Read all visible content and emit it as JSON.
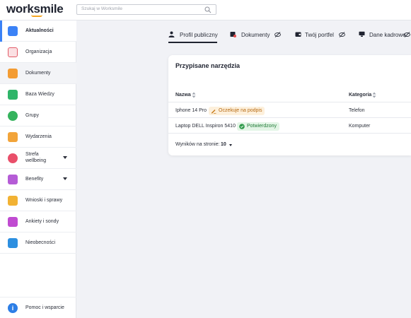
{
  "app": {
    "logo": "worksmile"
  },
  "search": {
    "placeholder": "Szukaj w Worksmile"
  },
  "sidebar": {
    "items": [
      {
        "label": "Aktualności",
        "icon": "news-icon",
        "color": "#3b82f6",
        "active": true
      },
      {
        "label": "Organizacja",
        "icon": "organization-icon",
        "color": "#e25b67"
      },
      {
        "label": "Dokumenty",
        "icon": "documents-icon",
        "color": "#f39c33",
        "hover": true
      },
      {
        "label": "Baza Wiedzy",
        "icon": "knowledge-base-icon",
        "color": "#2fb569"
      },
      {
        "label": "Grupy",
        "icon": "groups-icon",
        "color": "#35b35d"
      },
      {
        "label": "Wydarzenia",
        "icon": "events-icon",
        "color": "#f2a43a"
      },
      {
        "label": "Strefa wellbeing",
        "label_line1": "Strefa",
        "label_line2": "wellbeing",
        "icon": "wellbeing-icon",
        "color": "#e94f6a",
        "expandable": true
      },
      {
        "label": "Benefity",
        "icon": "benefits-icon",
        "color": "#b55cd6",
        "expandable": true
      },
      {
        "label": "Wnioski i sprawy",
        "icon": "requests-icon",
        "color": "#f2b233"
      },
      {
        "label": "Ankiety i sondy",
        "icon": "surveys-icon",
        "color": "#c04bd1"
      },
      {
        "label": "Nieobecności",
        "icon": "absences-icon",
        "color": "#2d8fe0"
      }
    ],
    "help": {
      "label": "Pomoc i wsparcie",
      "icon": "help-info-icon",
      "color": "#2d7ee6"
    }
  },
  "tabs": [
    {
      "label": "Profil publiczny",
      "icon": "person-icon",
      "active": true
    },
    {
      "label": "Dokumenty",
      "icon": "document-lock-icon",
      "hidden_icon": "eye-off-icon"
    },
    {
      "label": "Twój portfel",
      "icon": "wallet-icon",
      "hidden_icon": "eye-off-icon"
    },
    {
      "label": "Dane kadrowe",
      "icon": "hr-data-icon",
      "hidden_icon": "eye-off-icon"
    }
  ],
  "tools": {
    "title": "Przypisane narzędzia",
    "columns": {
      "name": "Nazwa",
      "category": "Kategoria"
    },
    "rows": [
      {
        "name": "Iphone 14 Pro",
        "status": "Oczekuje na podpis",
        "status_type": "pending",
        "category": "Telefon"
      },
      {
        "name": "Laptop DELL Inspiron 5410",
        "status": "Potwierdzony",
        "status_type": "confirmed",
        "category": "Komputer"
      }
    ],
    "per_page_label": "Wyników na stronie:",
    "per_page_value": "10"
  },
  "colors": {
    "accent": "#3b82f6",
    "logo_smile": "#f5a623",
    "pending_bg": "#fdf0dc",
    "confirmed_bg": "#e3f5e6"
  }
}
